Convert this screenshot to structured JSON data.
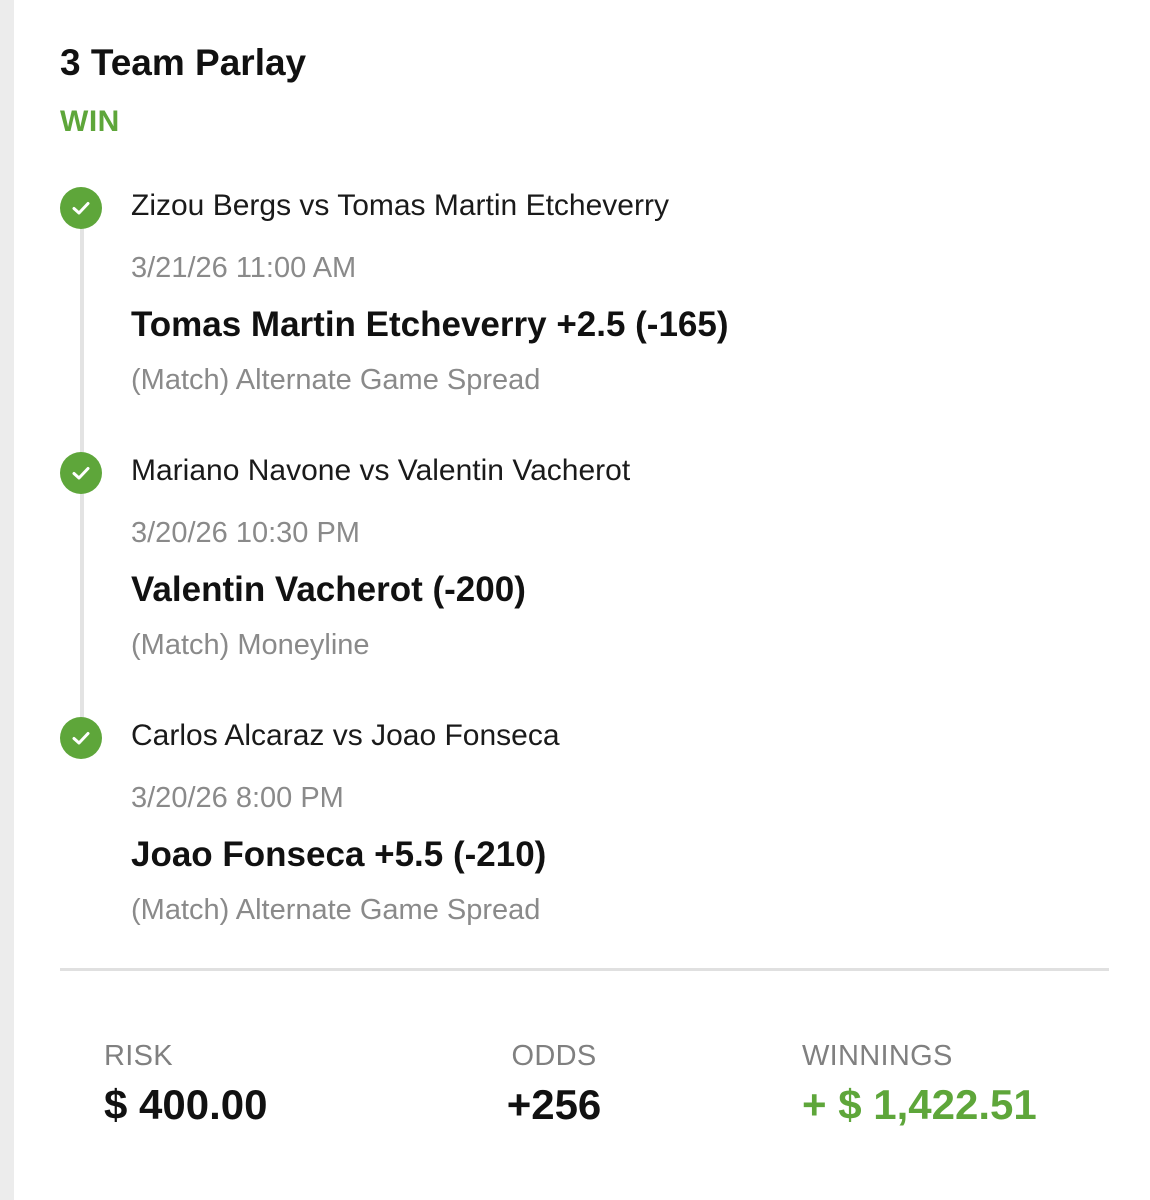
{
  "bet": {
    "title": "3 Team Parlay",
    "status": "WIN"
  },
  "legs": [
    {
      "matchup": "Zizou Bergs vs Tomas Martin Etcheverry",
      "datetime": "3/21/26 11:00 AM",
      "selection": "Tomas Martin Etcheverry +2.5 (-165)",
      "market": "(Match) Alternate Game Spread",
      "icon": "check-circle-icon"
    },
    {
      "matchup": "Mariano Navone vs Valentin Vacherot",
      "datetime": "3/20/26 10:30 PM",
      "selection": "Valentin Vacherot (-200)",
      "market": "(Match) Moneyline",
      "icon": "check-circle-icon"
    },
    {
      "matchup": "Carlos Alcaraz vs Joao Fonseca",
      "datetime": "3/20/26 8:00 PM",
      "selection": "Joao Fonseca +5.5 (-210)",
      "market": "(Match) Alternate Game Spread",
      "icon": "check-circle-icon"
    }
  ],
  "summary": {
    "risk_label": "RISK",
    "risk_value": "$ 400.00",
    "odds_label": "ODDS",
    "odds_value": "+256",
    "winnings_label": "WINNINGS",
    "winnings_value": "+ $ 1,422.51"
  },
  "colors": {
    "win_green": "#5ea63a",
    "muted_text": "#8a8a8a",
    "timeline": "#e3e3e3"
  }
}
